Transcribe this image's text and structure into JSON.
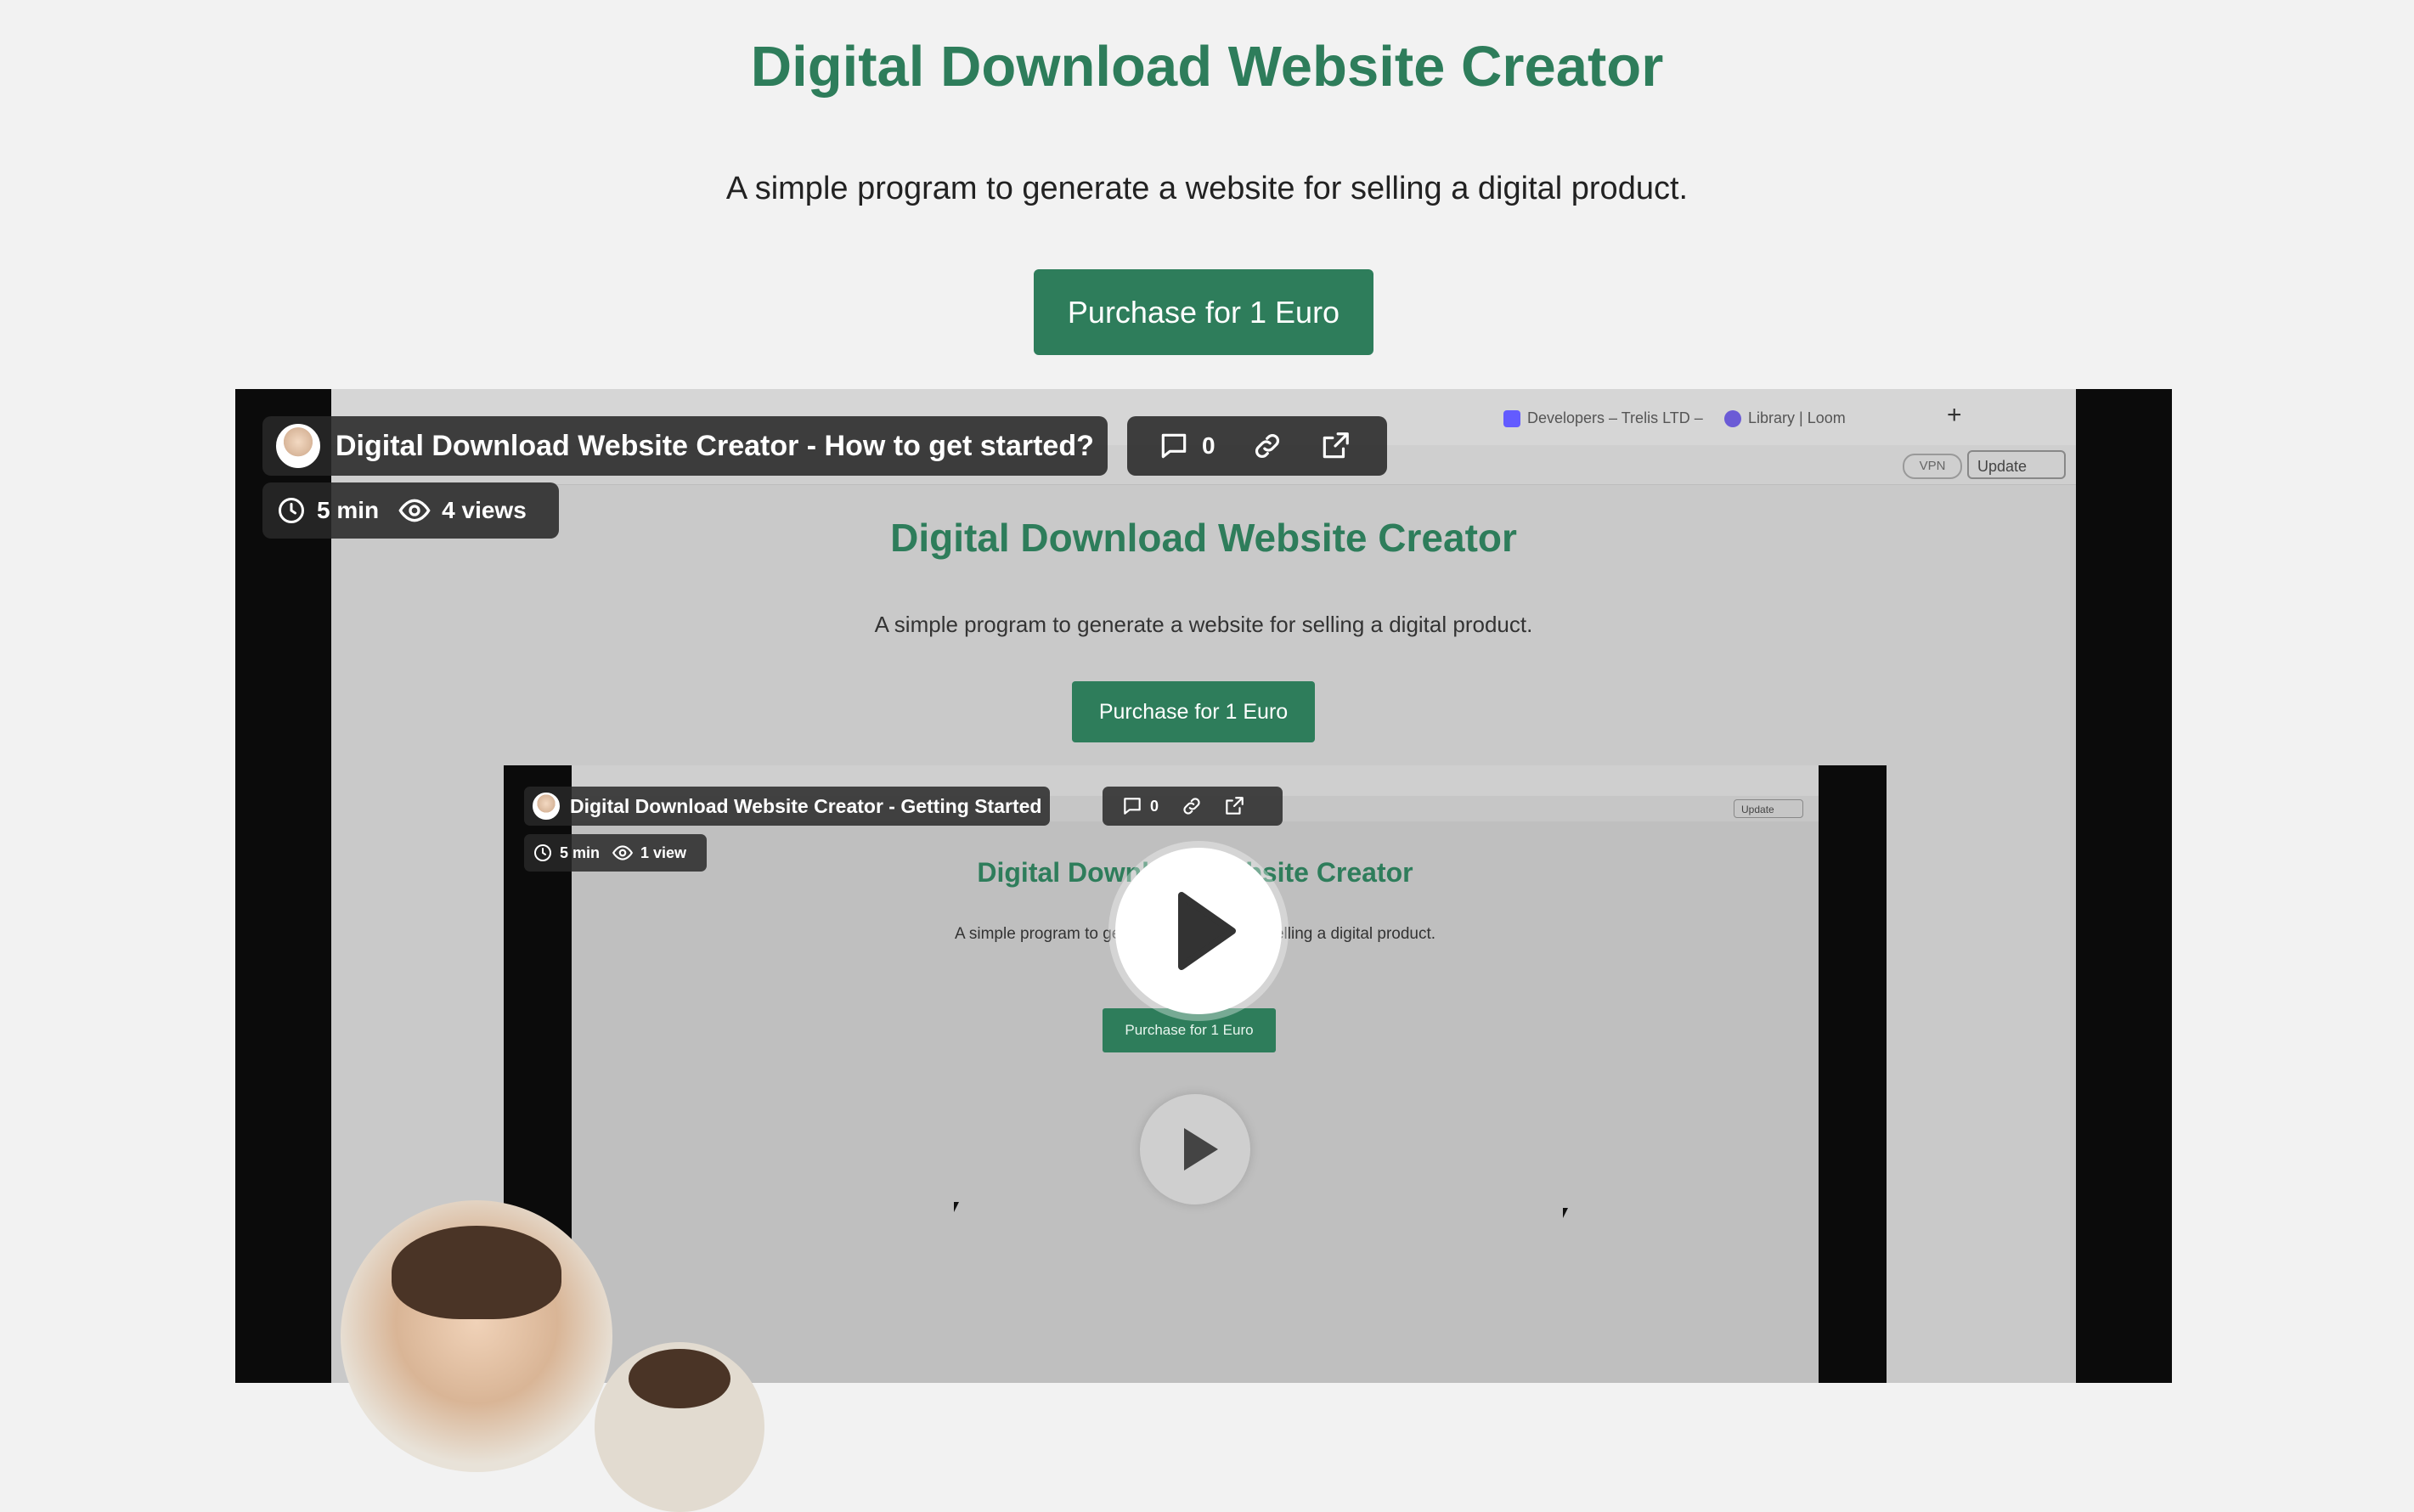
{
  "page": {
    "title": "Digital Download Website Creator",
    "subtitle": "A simple program to generate a website for selling a digital product.",
    "purchase_label": "Purchase for 1 Euro"
  },
  "video": {
    "title": "Digital Download Website Creator - How to get started?",
    "comments": "0",
    "duration": "5 min",
    "views": "4 views",
    "recording": {
      "tabs": [
        "Developers – Trelis LTD –",
        "Library | Loom"
      ],
      "toolbar": {
        "vpn": "VPN",
        "update": "Update"
      },
      "page_title": "Digital Download Website Creator",
      "page_subtitle": "A simple program to generate a website for selling a digital product.",
      "purchase_label": "Purchase for 1 Euro"
    },
    "nested_video": {
      "title": "Digital Download Website Creator - Getting Started",
      "comments": "0",
      "duration": "5 min",
      "views": "1 view",
      "update": "Update",
      "page_title": "Digital Download Website Creator",
      "page_subtitle": "A simple program to generate a website for selling a digital product.",
      "purchase_label": "Purchase for 1 Euro"
    }
  },
  "colors": {
    "brand_green": "#2e7d5b",
    "page_background": "#f2f2f2"
  }
}
